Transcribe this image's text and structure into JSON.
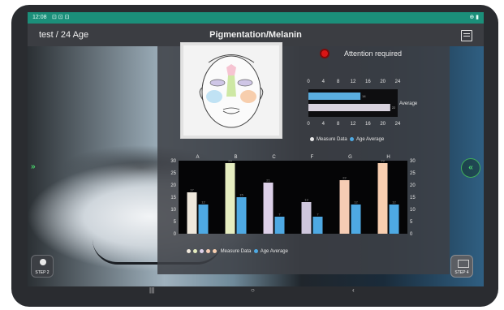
{
  "status_bar": {
    "time": "12:08",
    "icons": "⊡ ⊡ ⊡",
    "right_icons": "⊕ ▮"
  },
  "header": {
    "user_label": "test / 24 Age",
    "title": "Pigmentation/Melanin"
  },
  "attention": {
    "text": "Attention required",
    "color": "#d91515"
  },
  "summary_chart": {
    "type": "bar",
    "orientation": "horizontal",
    "ticks": [
      "0",
      "4",
      "8",
      "12",
      "16",
      "20",
      "24"
    ],
    "xlim": [
      0,
      24
    ],
    "bars": [
      {
        "name": "Measure Data",
        "value": 14,
        "label": "14",
        "color": "#5aaee0"
      },
      {
        "name": "Age Average",
        "value": 22,
        "label": "22",
        "color": "#d8d2de"
      }
    ],
    "side_label": "Average"
  },
  "summary_legend": {
    "measure": "Measure Data",
    "age": "Age Average"
  },
  "chart_data": {
    "type": "bar",
    "categories": [
      "A",
      "B",
      "C",
      "F",
      "G",
      "H"
    ],
    "ylim": [
      0,
      30
    ],
    "yticks": [
      "0",
      "5",
      "10",
      "15",
      "20",
      "25",
      "30"
    ],
    "series": [
      {
        "name": "Measure Data",
        "values": [
          17,
          29,
          21,
          13,
          22,
          29
        ],
        "colors": [
          "#efe8dc",
          "#e6edc0",
          "#ddd0e8",
          "#cfc7dd",
          "#f6ccb4",
          "#f9cfb0"
        ]
      },
      {
        "name": "Age Average",
        "values": [
          12,
          15,
          7,
          7,
          12,
          12
        ],
        "color": "#4ea9e3"
      }
    ]
  },
  "main_legend": {
    "measure": "Measure Data",
    "age": "Age Average"
  },
  "nav": {
    "left_arrow": "»",
    "right_arrow": "«",
    "step_left": "STEP 2",
    "step_right": "STEP 4"
  },
  "android_nav": {
    "recent": "|||",
    "home": "○",
    "back": "‹"
  }
}
